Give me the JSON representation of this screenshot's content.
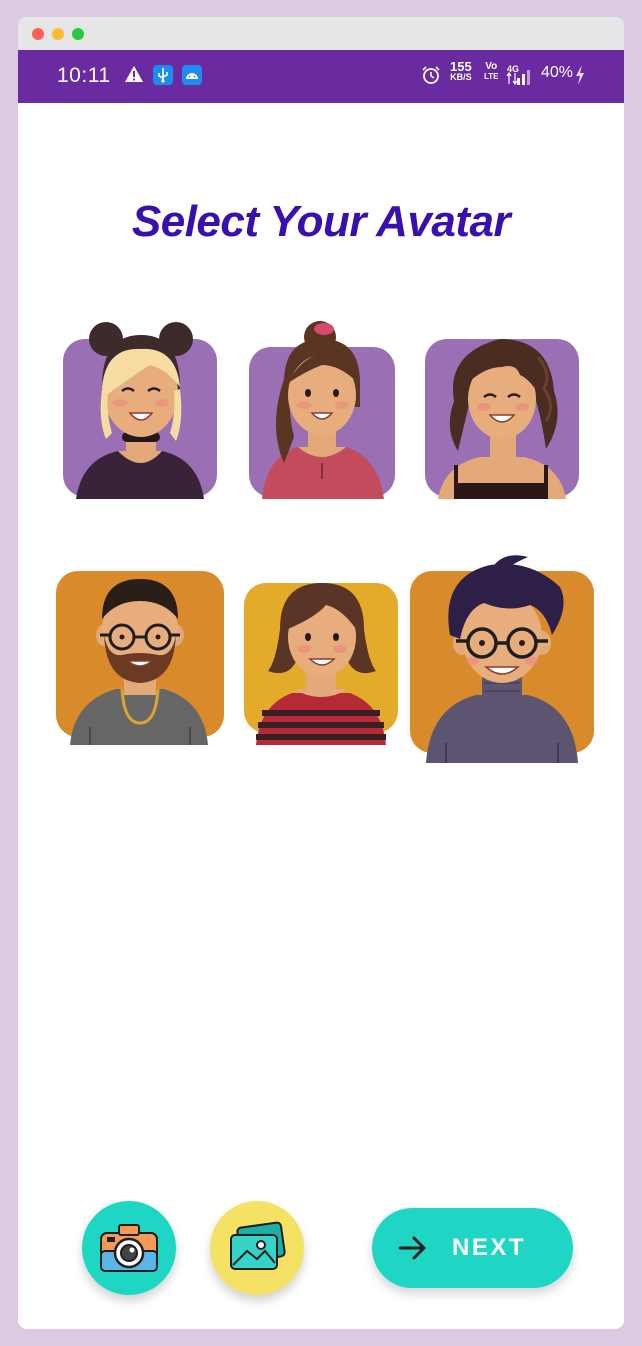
{
  "status_bar": {
    "time": "10:11",
    "net_speed": "155",
    "net_speed_unit": "KB/S",
    "volte_top": "Vo",
    "volte_bottom": "LTE",
    "network": "4G",
    "battery": "40%"
  },
  "page": {
    "title": "Select Your Avatar"
  },
  "colors": {
    "title": "#3a0fb0",
    "status_bar": "#6a2ba1",
    "accent_teal": "#1ed6c3",
    "accent_yellow": "#f5e264",
    "avatar_bg_purple": "#9a6fb4",
    "avatar_bg_orange": "#d98a2a",
    "avatar_bg_amber": "#e4aa2a"
  },
  "avatars": [
    {
      "name": "avatar-girl-buns",
      "background": "purple"
    },
    {
      "name": "avatar-girl-ponytail",
      "background": "purple"
    },
    {
      "name": "avatar-girl-curly",
      "background": "purple"
    },
    {
      "name": "avatar-man-beard",
      "background": "orange"
    },
    {
      "name": "avatar-boy-striped",
      "background": "amber"
    },
    {
      "name": "avatar-man-glasses",
      "background": "orange"
    }
  ],
  "actions": {
    "camera_icon": "camera-icon",
    "gallery_icon": "image-gallery-icon",
    "next_label": "NEXT",
    "next_icon": "arrow-right-icon"
  }
}
